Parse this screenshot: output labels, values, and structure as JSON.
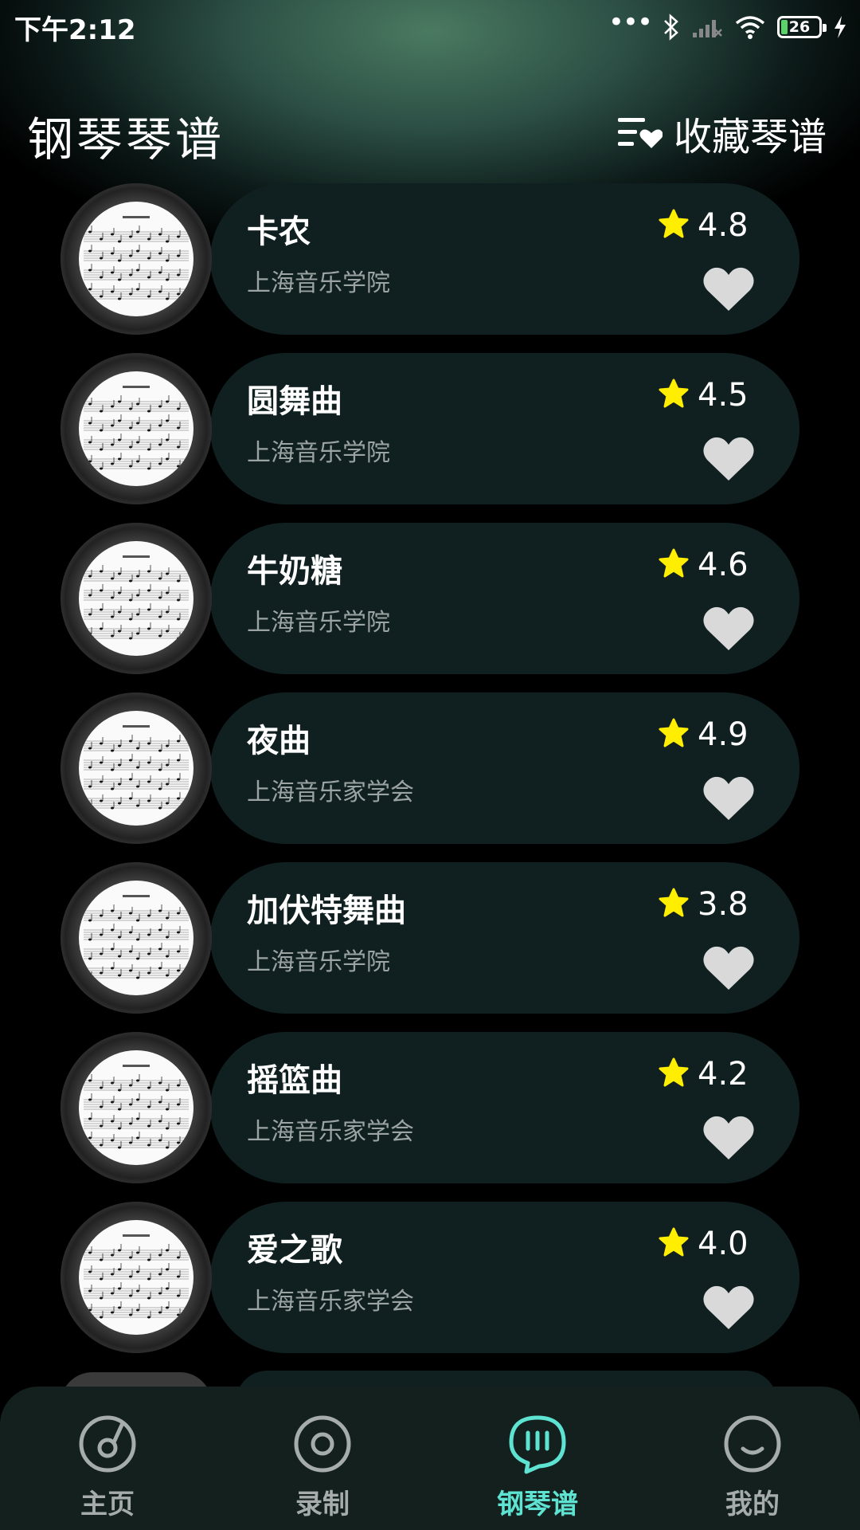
{
  "status_bar": {
    "time": "下午2:12",
    "battery": "26"
  },
  "header": {
    "title": "钢琴琴谱",
    "favorites_label": "收藏琴谱"
  },
  "scores": [
    {
      "title": "卡农",
      "source": "上海音乐学院",
      "rating": "4.8"
    },
    {
      "title": "圆舞曲",
      "source": "上海音乐学院",
      "rating": "4.5"
    },
    {
      "title": "牛奶糖",
      "source": "上海音乐学院",
      "rating": "4.6"
    },
    {
      "title": "夜曲",
      "source": "上海音乐家学会",
      "rating": "4.9"
    },
    {
      "title": "加伏特舞曲",
      "source": "上海音乐学院",
      "rating": "3.8"
    },
    {
      "title": "摇篮曲",
      "source": "上海音乐家学会",
      "rating": "4.2"
    },
    {
      "title": "爱之歌",
      "source": "上海音乐家学会",
      "rating": "4.0"
    }
  ],
  "nav": [
    {
      "label": "主页",
      "icon": "home-disc-icon",
      "active": false
    },
    {
      "label": "录制",
      "icon": "record-icon",
      "active": false
    },
    {
      "label": "钢琴谱",
      "icon": "score-chat-icon",
      "active": true
    },
    {
      "label": "我的",
      "icon": "smile-icon",
      "active": false
    }
  ],
  "colors": {
    "accent": "#5ee3d2",
    "star": "#ffee00",
    "card": "#102020",
    "nav_bg": "#13201e"
  }
}
